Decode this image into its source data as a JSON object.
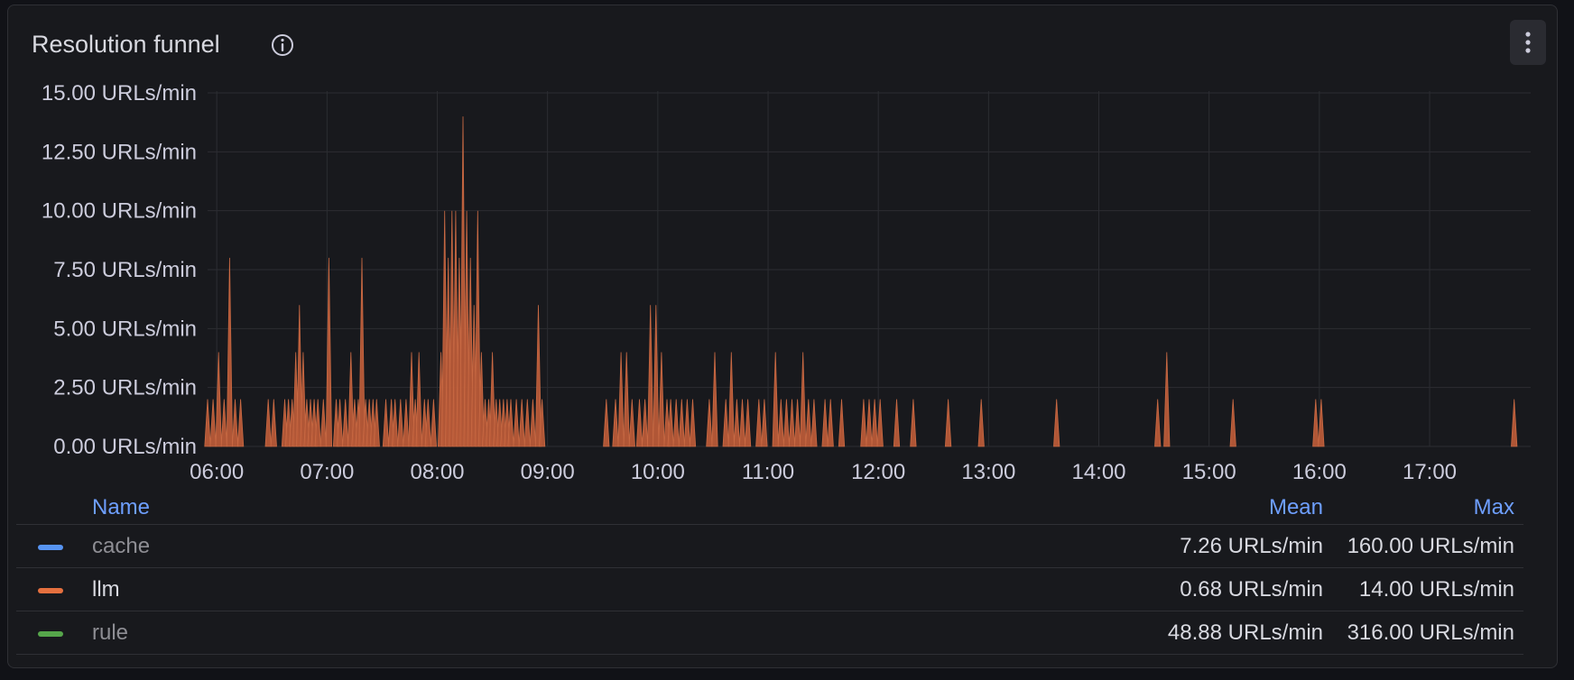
{
  "panel": {
    "title": "Resolution funnel",
    "info_icon": "info-circle-icon",
    "menu_icon": "kebab-menu-icon"
  },
  "colors": {
    "llm": "#b85a38",
    "cache": "#5794f2",
    "llm_swatch": "#e5703f",
    "rule": "#56a64b",
    "grid": "#2c2d32",
    "axis_text": "#ccccdc",
    "legend_header": "#6e9fff"
  },
  "chart_data": {
    "type": "area",
    "ylim": [
      0,
      15
    ],
    "yticks": [
      0,
      2.5,
      5,
      7.5,
      10,
      12.5,
      15
    ],
    "ytick_labels": [
      "0.00  URLs/min",
      "2.50  URLs/min",
      "5.00  URLs/min",
      "7.50  URLs/min",
      "10.00  URLs/min",
      "12.50  URLs/min",
      "15.00  URLs/min"
    ],
    "xlim": [
      "05:55",
      "17:55"
    ],
    "xticks": [
      "06:00",
      "07:00",
      "08:00",
      "09:00",
      "10:00",
      "11:00",
      "12:00",
      "13:00",
      "14:00",
      "15:00",
      "16:00",
      "17:00"
    ],
    "grid": true,
    "legend_placement": "bottom",
    "series": [
      {
        "name": "llm",
        "x": [
          "05:55",
          "05:58",
          "06:01",
          "06:04",
          "06:07",
          "06:10",
          "06:13",
          "06:28",
          "06:31",
          "06:37",
          "06:39",
          "06:41",
          "06:43",
          "06:45",
          "06:47",
          "06:49",
          "06:51",
          "06:53",
          "06:55",
          "06:58",
          "07:01",
          "07:05",
          "07:07",
          "07:10",
          "07:13",
          "07:15",
          "07:17",
          "07:19",
          "07:21",
          "07:23",
          "07:25",
          "07:27",
          "07:32",
          "07:35",
          "07:37",
          "07:40",
          "07:43",
          "07:46",
          "07:48",
          "07:50",
          "07:53",
          "07:55",
          "07:58",
          "08:02",
          "08:04",
          "08:06",
          "08:08",
          "08:10",
          "08:12",
          "08:14",
          "08:16",
          "08:18",
          "08:20",
          "08:22",
          "08:24",
          "08:26",
          "08:28",
          "08:30",
          "08:32",
          "08:34",
          "08:36",
          "08:38",
          "08:40",
          "08:43",
          "08:46",
          "08:49",
          "08:52",
          "08:55",
          "08:57",
          "09:32",
          "09:37",
          "09:40",
          "09:43",
          "09:46",
          "09:50",
          "09:53",
          "09:56",
          "09:59",
          "10:02",
          "10:05",
          "10:07",
          "10:10",
          "10:13",
          "10:16",
          "10:19",
          "10:28",
          "10:31",
          "10:37",
          "10:40",
          "10:43",
          "10:46",
          "10:49",
          "10:55",
          "10:58",
          "11:04",
          "11:07",
          "11:10",
          "11:13",
          "11:16",
          "11:19",
          "11:22",
          "11:25",
          "11:31",
          "11:34",
          "11:40",
          "11:52",
          "11:55",
          "11:58",
          "12:01",
          "12:10",
          "12:19",
          "12:38",
          "12:56",
          "13:37",
          "14:32",
          "14:37",
          "15:13",
          "15:58",
          "16:01",
          "17:46"
        ],
        "values": [
          2,
          2,
          4,
          2,
          8,
          2,
          2,
          2,
          2,
          2,
          2,
          2,
          4,
          6,
          4,
          2,
          2,
          2,
          2,
          2,
          8,
          2,
          2,
          2,
          4,
          2,
          2,
          8,
          2,
          2,
          2,
          2,
          2,
          2,
          2,
          2,
          2,
          4,
          2,
          4,
          2,
          2,
          2,
          4,
          10,
          8,
          10,
          10,
          8,
          14,
          10,
          8,
          6,
          10,
          4,
          2,
          2,
          4,
          2,
          2,
          2,
          2,
          2,
          2,
          2,
          2,
          2,
          6,
          2,
          2,
          2,
          4,
          4,
          2,
          2,
          2,
          6,
          6,
          4,
          2,
          2,
          2,
          2,
          2,
          2,
          2,
          4,
          2,
          4,
          2,
          2,
          2,
          2,
          2,
          4,
          2,
          2,
          2,
          2,
          4,
          2,
          2,
          2,
          2,
          2,
          2,
          2,
          2,
          2,
          2,
          2,
          2,
          2,
          2,
          2,
          4,
          2,
          2,
          2,
          2
        ]
      },
      {
        "name": "cache",
        "values": []
      },
      {
        "name": "rule",
        "values": []
      }
    ]
  },
  "legend": {
    "header_name": "Name",
    "header_mean": "Mean",
    "header_max": "Max",
    "rows": [
      {
        "name": "cache",
        "mean": "7.26 URLs/min",
        "max": "160.00 URLs/min"
      },
      {
        "name": "llm",
        "mean": "0.68 URLs/min",
        "max": "14.00 URLs/min"
      },
      {
        "name": "rule",
        "mean": "48.88 URLs/min",
        "max": "316.00 URLs/min"
      }
    ]
  }
}
